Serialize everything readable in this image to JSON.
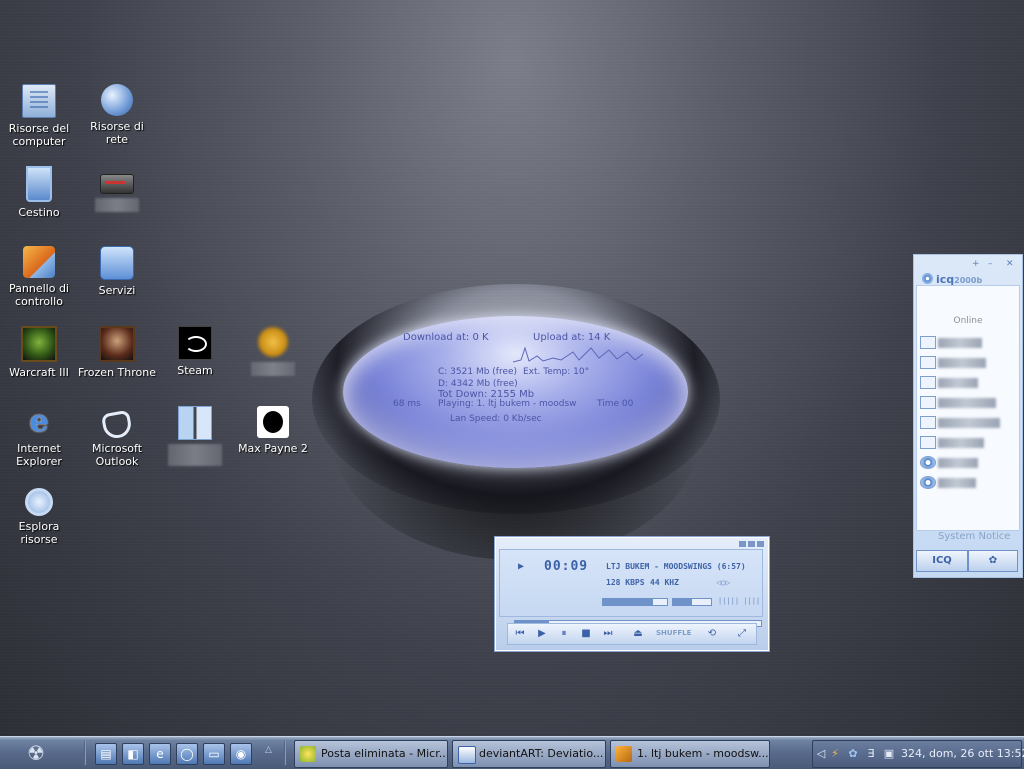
{
  "desktop": {
    "icons": [
      {
        "label": "Risorse del computer"
      },
      {
        "label": "Risorse di rete"
      },
      {
        "label": "Cestino"
      },
      {
        "label": ""
      },
      {
        "label": "Pannello di controllo"
      },
      {
        "label": "Servizi"
      },
      {
        "label": "Warcraft III"
      },
      {
        "label": "Frozen Throne"
      },
      {
        "label": "Steam"
      },
      {
        "label": ""
      },
      {
        "label": "Internet Explorer"
      },
      {
        "label": "Microsoft Outlook"
      },
      {
        "label": ""
      },
      {
        "label": "Max Payne 2"
      },
      {
        "label": "Esplora risorse"
      }
    ]
  },
  "monitor_widget": {
    "download": "Download at: 0 K",
    "upload": "Upload at: 14 K",
    "disk_c": "C: 3521 Mb (free)",
    "ext_temp": "Ext. Temp: 10°",
    "disk_d": "D: 4342 Mb (free)",
    "tot_down": "Tot Down: 2155 Mb",
    "ping": "68 ms",
    "playing": "Playing: 1. ltj bukem - moodsw",
    "time": "Time 00",
    "lan_speed": "Lan Speed: 0 Kb/sec"
  },
  "player": {
    "time": "00:09",
    "track": "LTJ BUKEM - MOODSWINGS (6:57)",
    "bitrate": "128 KBPS",
    "samplerate": "44 KHZ",
    "shuffle_label": "SHUFFLE",
    "volume": 0.78,
    "balance": 0.5,
    "position": 0.14
  },
  "icq": {
    "brand": "icq",
    "version": "2000b",
    "status": "Online",
    "contacts": [
      {
        "icon": "card-icon"
      },
      {
        "icon": "card-icon"
      },
      {
        "icon": "card-icon"
      },
      {
        "icon": "card-icon"
      },
      {
        "icon": "card-icon"
      },
      {
        "icon": "card-icon"
      },
      {
        "icon": "flower-icon"
      },
      {
        "icon": "flower-icon"
      }
    ],
    "system_notice": "System Notice",
    "tab_icq": "ICQ"
  },
  "taskbar": {
    "tasks": [
      {
        "label": "Posta eliminata - Micr..."
      },
      {
        "label": "deviantART: Deviatio..."
      },
      {
        "label": "1. ltj bukem - moodsw..."
      }
    ],
    "clock": "324, dom, 26 ott 13:52"
  },
  "colors": {
    "lens": "#7a84d8",
    "panel": "#c6d8f2",
    "taskbar": "#58698a"
  }
}
